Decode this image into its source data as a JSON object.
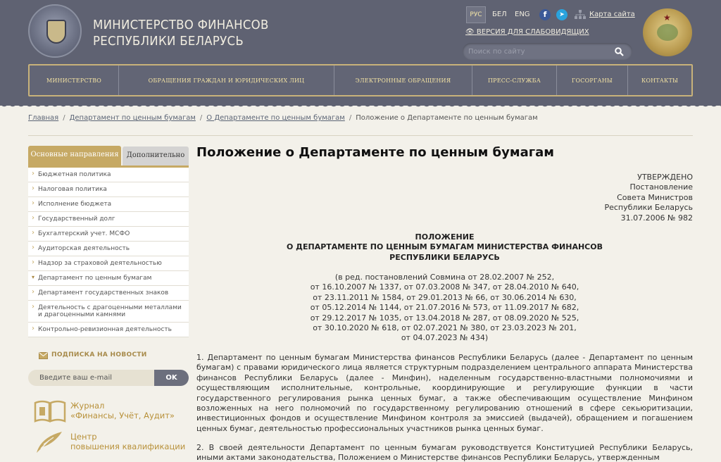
{
  "header": {
    "title_line1": "МИНИСТЕРСТВО ФИНАНСОВ",
    "title_line2": "РЕСПУБЛИКИ БЕЛАРУСЬ",
    "langs": {
      "active": "РУС",
      "bel": "БЕЛ",
      "eng": "ENG"
    },
    "sitemap": "Карта сайта",
    "vision": "ВЕРСИЯ ДЛЯ СЛАБОВИДЯЩИХ",
    "search_placeholder": "Поиск по сайту"
  },
  "nav": [
    "МИНИСТЕРСТВО",
    "ОБРАЩЕНИЯ ГРАЖДАН И ЮРИДИЧЕСКИХ ЛИЦ",
    "ЭЛЕКТРОННЫЕ ОБРАЩЕНИЯ",
    "ПРЕСС-СЛУЖБА",
    "ГОСОРГАНЫ",
    "КОНТАКТЫ"
  ],
  "breadcrumb": {
    "home": "Главная",
    "dept": "Департамент по ценным бумагам",
    "about": "О Департаменте по ценным бумагам",
    "current": "Положение о Департаменте по ценным бумагам"
  },
  "sidebar": {
    "tab_main": "Основные направления",
    "tab_extra": "Дополнительно",
    "items": [
      "Бюджетная политика",
      "Налоговая политика",
      "Исполнение бюджета",
      "Государственный долг",
      "Бухгалтерский учет. МСФО",
      "Аудиторская деятельность",
      "Надзор за страховой деятельностью",
      "Департамент по ценным бумагам",
      "Департамент государственных знаков",
      "Деятельность с драгоценными металлами и драгоценными камнями",
      "Контрольно-ревизионная деятельность"
    ],
    "subscribe_label": "ПОДПИСКА НА НОВОСТИ",
    "email_placeholder": "Введите ваш e-mail",
    "ok": "OK",
    "journal_line1": "Журнал",
    "journal_line2": "«Финансы, Учёт, Аудит»",
    "center_line1": "Центр",
    "center_line2": "повышения квалификации"
  },
  "content": {
    "title": "Положение о Департаменте по ценным бумагам",
    "approved": "УТВЕРЖДЕНО\nПостановление\nСовета Министров\nРеспублики Беларусь\n31.07.2006 № 982",
    "doc_title": "ПОЛОЖЕНИЕ\nО ДЕПАРТАМЕНТЕ ПО ЦЕННЫМ БУМАГАМ МИНИСТЕРСТВА ФИНАНСОВ\nРЕСПУБЛИКИ БЕЛАРУСЬ",
    "revisions": "(в ред. постановлений Совмина от 28.02.2007 № 252,\nот 16.10.2007 № 1337, от 07.03.2008 № 347, от 28.04.2010 № 640,\nот 23.11.2011 № 1584, от 29.01.2013 № 66, от 30.06.2014 № 630,\nот 05.12.2014 № 1144, от 21.07.2016 № 573, от 11.09.2017 № 682,\nот 29.12.2017 № 1035, от 13.04.2018 № 287, от 08.09.2020 № 525,\nот 30.10.2020 № 618, от 02.07.2021 № 380, от 23.03.2023 № 201,\nот 04.07.2023 № 434)",
    "para1": "1. Департамент по ценным бумагам Министерства финансов Республики Беларусь (далее - Департамент по ценным бумагам) с правами юридического лица является структурным подразделением центрального аппарата Министерства финансов Республики Беларусь (далее - Минфин), наделенным государственно-властными полномочиями и осуществляющим исполнительные, контрольные, координирующие и регулирующие функции в части государственного регулирования рынка ценных бумаг, а также обеспечивающим осуществление Минфином возложенных на него полномочий по государственному регулированию отношений в сфере секьюритизации, инвестиционных фондов и осуществление Минфином контроля за эмиссией (выдачей), обращением и погашением ценных бумаг, деятельностью профессиональных участников рынка ценных бумаг.",
    "para2": "2. В своей деятельности Департамент по ценным бумагам руководствуется Конституцией Республики Беларусь, иными актами законодательства, Положением о Министерстве финансов Республики Беларусь, утвержденным"
  },
  "colors": {
    "header": "#5f6272",
    "gold": "#c6a964",
    "nav_text": "#f4e3a3"
  }
}
